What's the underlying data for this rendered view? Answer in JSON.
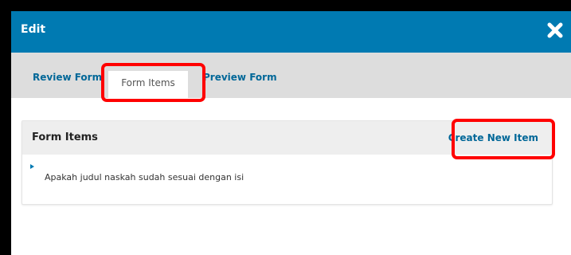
{
  "modal": {
    "title": "Edit",
    "close_icon": "close-icon"
  },
  "tabs": [
    {
      "label": "Review Form",
      "active": false
    },
    {
      "label": "Form Items",
      "active": true
    },
    {
      "label": "Preview Form",
      "active": false
    }
  ],
  "panel": {
    "title": "Form Items",
    "create_label": "Create New Item",
    "items": [
      {
        "text": "Apakah judul naskah sudah sesuai dengan isi",
        "expand_icon": "triangle-right-icon"
      }
    ]
  },
  "colors": {
    "header": "#007ab2",
    "link": "#006798",
    "tabbar": "#dddddd",
    "highlight": "#ff0000",
    "backdrop": "#000000"
  }
}
